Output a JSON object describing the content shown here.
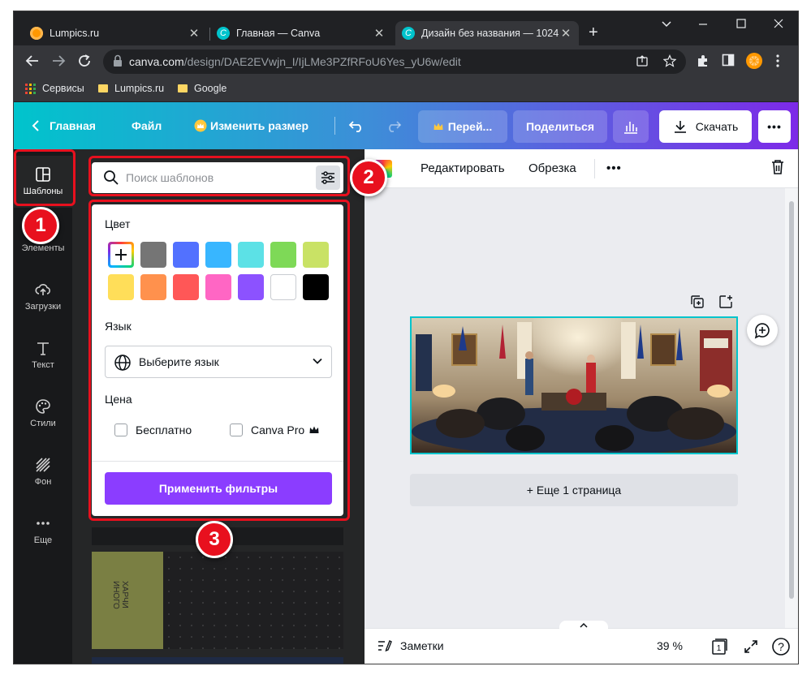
{
  "browser": {
    "tabs": [
      {
        "title": "Lumpics.ru",
        "favicon_color": "#ff9800"
      },
      {
        "title": "Главная — Canva",
        "favicon_color": "#00c4cc"
      },
      {
        "title": "Дизайн без названия — 1024",
        "favicon_color": "#00c4cc",
        "active": true
      }
    ],
    "new_tab": "+",
    "address": {
      "host": "canva.com",
      "path": "/design/DAE2EVwjn_I/IjLMe3PZfRFoU6Yes_yU6w/edit"
    },
    "bookmarks": [
      {
        "label": "Сервисы"
      },
      {
        "label": "Lumpics.ru"
      },
      {
        "label": "Google"
      }
    ]
  },
  "canva_header": {
    "back_label": "Главная",
    "file_label": "Файл",
    "resize_label": "Изменить размер",
    "upgrade_label": "Перей...",
    "share_label": "Поделиться",
    "download_label": "Скачать",
    "more_label": "•••"
  },
  "rail": {
    "items": [
      {
        "label": "Шаблоны",
        "icon": "templates-icon"
      },
      {
        "label": "Элементы",
        "icon": "elements-icon"
      },
      {
        "label": "Загрузки",
        "icon": "uploads-icon"
      },
      {
        "label": "Текст",
        "icon": "text-icon"
      },
      {
        "label": "Стили",
        "icon": "styles-icon"
      },
      {
        "label": "Фон",
        "icon": "background-icon"
      },
      {
        "label": "Еще",
        "icon": "more-icon"
      }
    ]
  },
  "panel": {
    "search_placeholder": "Поиск шаблонов",
    "filters": {
      "color_title": "Цвет",
      "colors": [
        "add",
        "#757575",
        "#5271ff",
        "#38b6ff",
        "#5ce1e6",
        "#7ed957",
        "#c9e265",
        "#ffde59",
        "#ff914d",
        "#ff5757",
        "#ff66c4",
        "#8c52ff",
        "#ffffff",
        "#000000"
      ],
      "language_title": "Язык",
      "language_placeholder": "Выберите язык",
      "price_title": "Цена",
      "price_free": "Бесплатно",
      "price_pro": "Canva Pro",
      "apply_label": "Применить фильтры"
    },
    "thumbnail_text": "ХАРЧИ\nИНОГО"
  },
  "editor": {
    "edit_label": "Редактировать",
    "crop_label": "Обрезка",
    "more_label": "•••",
    "more_pages_label": "+ Еще 1 страница"
  },
  "footer": {
    "notes_label": "Заметки",
    "zoom": "39 %",
    "page_number": "1",
    "help": "?"
  },
  "annotations": {
    "badge_1": "1",
    "badge_2": "2",
    "badge_3": "3"
  },
  "colors": {
    "accent_purple": "#8b3dff",
    "annotation_red": "#e8101e",
    "selection_teal": "#00c4cc"
  }
}
